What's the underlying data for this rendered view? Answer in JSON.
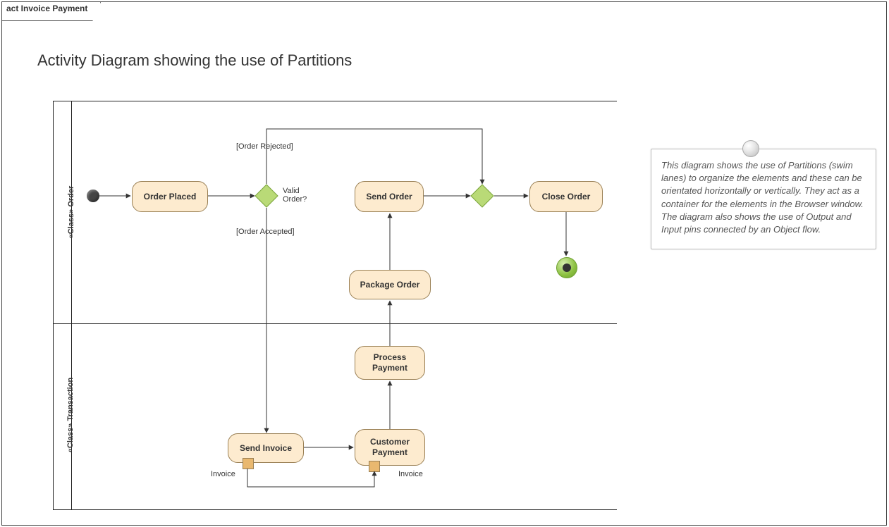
{
  "frame": {
    "title": "act Invoice Payment"
  },
  "heading": "Activity Diagram showing the use of Partitions",
  "lanes": {
    "order": "«Class» Order",
    "transaction": "«Class» Transaction"
  },
  "nodes": {
    "order_placed": "Order Placed",
    "send_order": "Send Order",
    "close_order": "Close Order",
    "package_order": "Package Order",
    "process_payment": "Process\nPayment",
    "send_invoice": "Send Invoice",
    "customer_payment": "Customer\nPayment",
    "valid_order": "Valid\nOrder?"
  },
  "guards": {
    "rejected": "[Order Rejected]",
    "accepted": "[Order Accepted]"
  },
  "pins": {
    "out": "Invoice",
    "in": "Invoice"
  },
  "note": "This diagram shows the use of Partitions (swim lanes) to organize the elements and these can be orientated horizontally or vertically. They act as a container for the elements in the Browser window. The diagram also shows the use of Output and Input pins connected by an Object flow."
}
